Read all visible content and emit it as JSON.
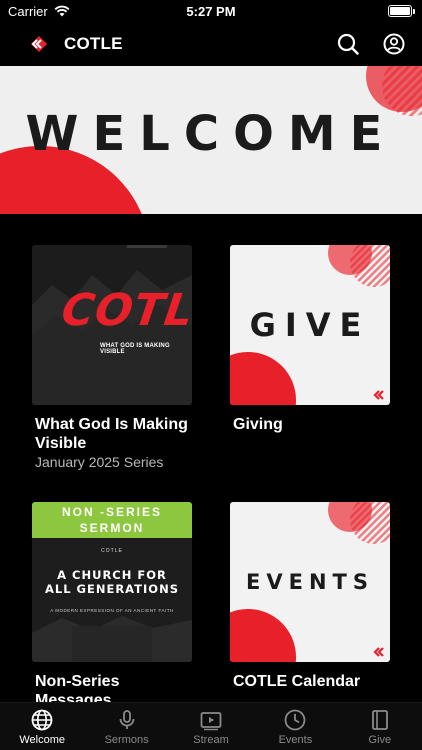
{
  "status_bar": {
    "carrier": "Carrier",
    "time": "5:27 PM",
    "battery_level": 1.0
  },
  "header": {
    "title": "COTLE"
  },
  "banner": {
    "title": "WELCOME"
  },
  "cards": [
    {
      "title": "What God Is Making Visible",
      "subtitle": "January 2025 Series",
      "thumb_brand": "COTLE",
      "thumb_tagline": "WHAT GOD IS MAKING VISIBLE"
    },
    {
      "title": "Giving",
      "subtitle": "",
      "thumb_word": "GIVE"
    },
    {
      "title": "Non-Series Messages",
      "subtitle": "",
      "thumb_banner": "NON -SERIES SERMON",
      "thumb_brand": "COTLE",
      "thumb_headline": "A CHURCH FOR ALL GENERATIONS",
      "thumb_tagline": "A MODERN EXPRESSION OF AN ANCIENT FAITH"
    },
    {
      "title": "COTLE Calendar",
      "subtitle": "",
      "thumb_word": "EVENTS"
    }
  ],
  "tabs": [
    {
      "label": "Welcome",
      "icon": "globe-icon",
      "active": true
    },
    {
      "label": "Sermons",
      "icon": "microphone-icon",
      "active": false
    },
    {
      "label": "Stream",
      "icon": "video-play-icon",
      "active": false
    },
    {
      "label": "Events",
      "icon": "clock-icon",
      "active": false
    },
    {
      "label": "Give",
      "icon": "book-icon",
      "active": false
    }
  ],
  "colors": {
    "accent_red": "#e8202a",
    "background": "#000000",
    "tab_inactive": "#8a8a8a",
    "lime": "#8dc63f"
  }
}
